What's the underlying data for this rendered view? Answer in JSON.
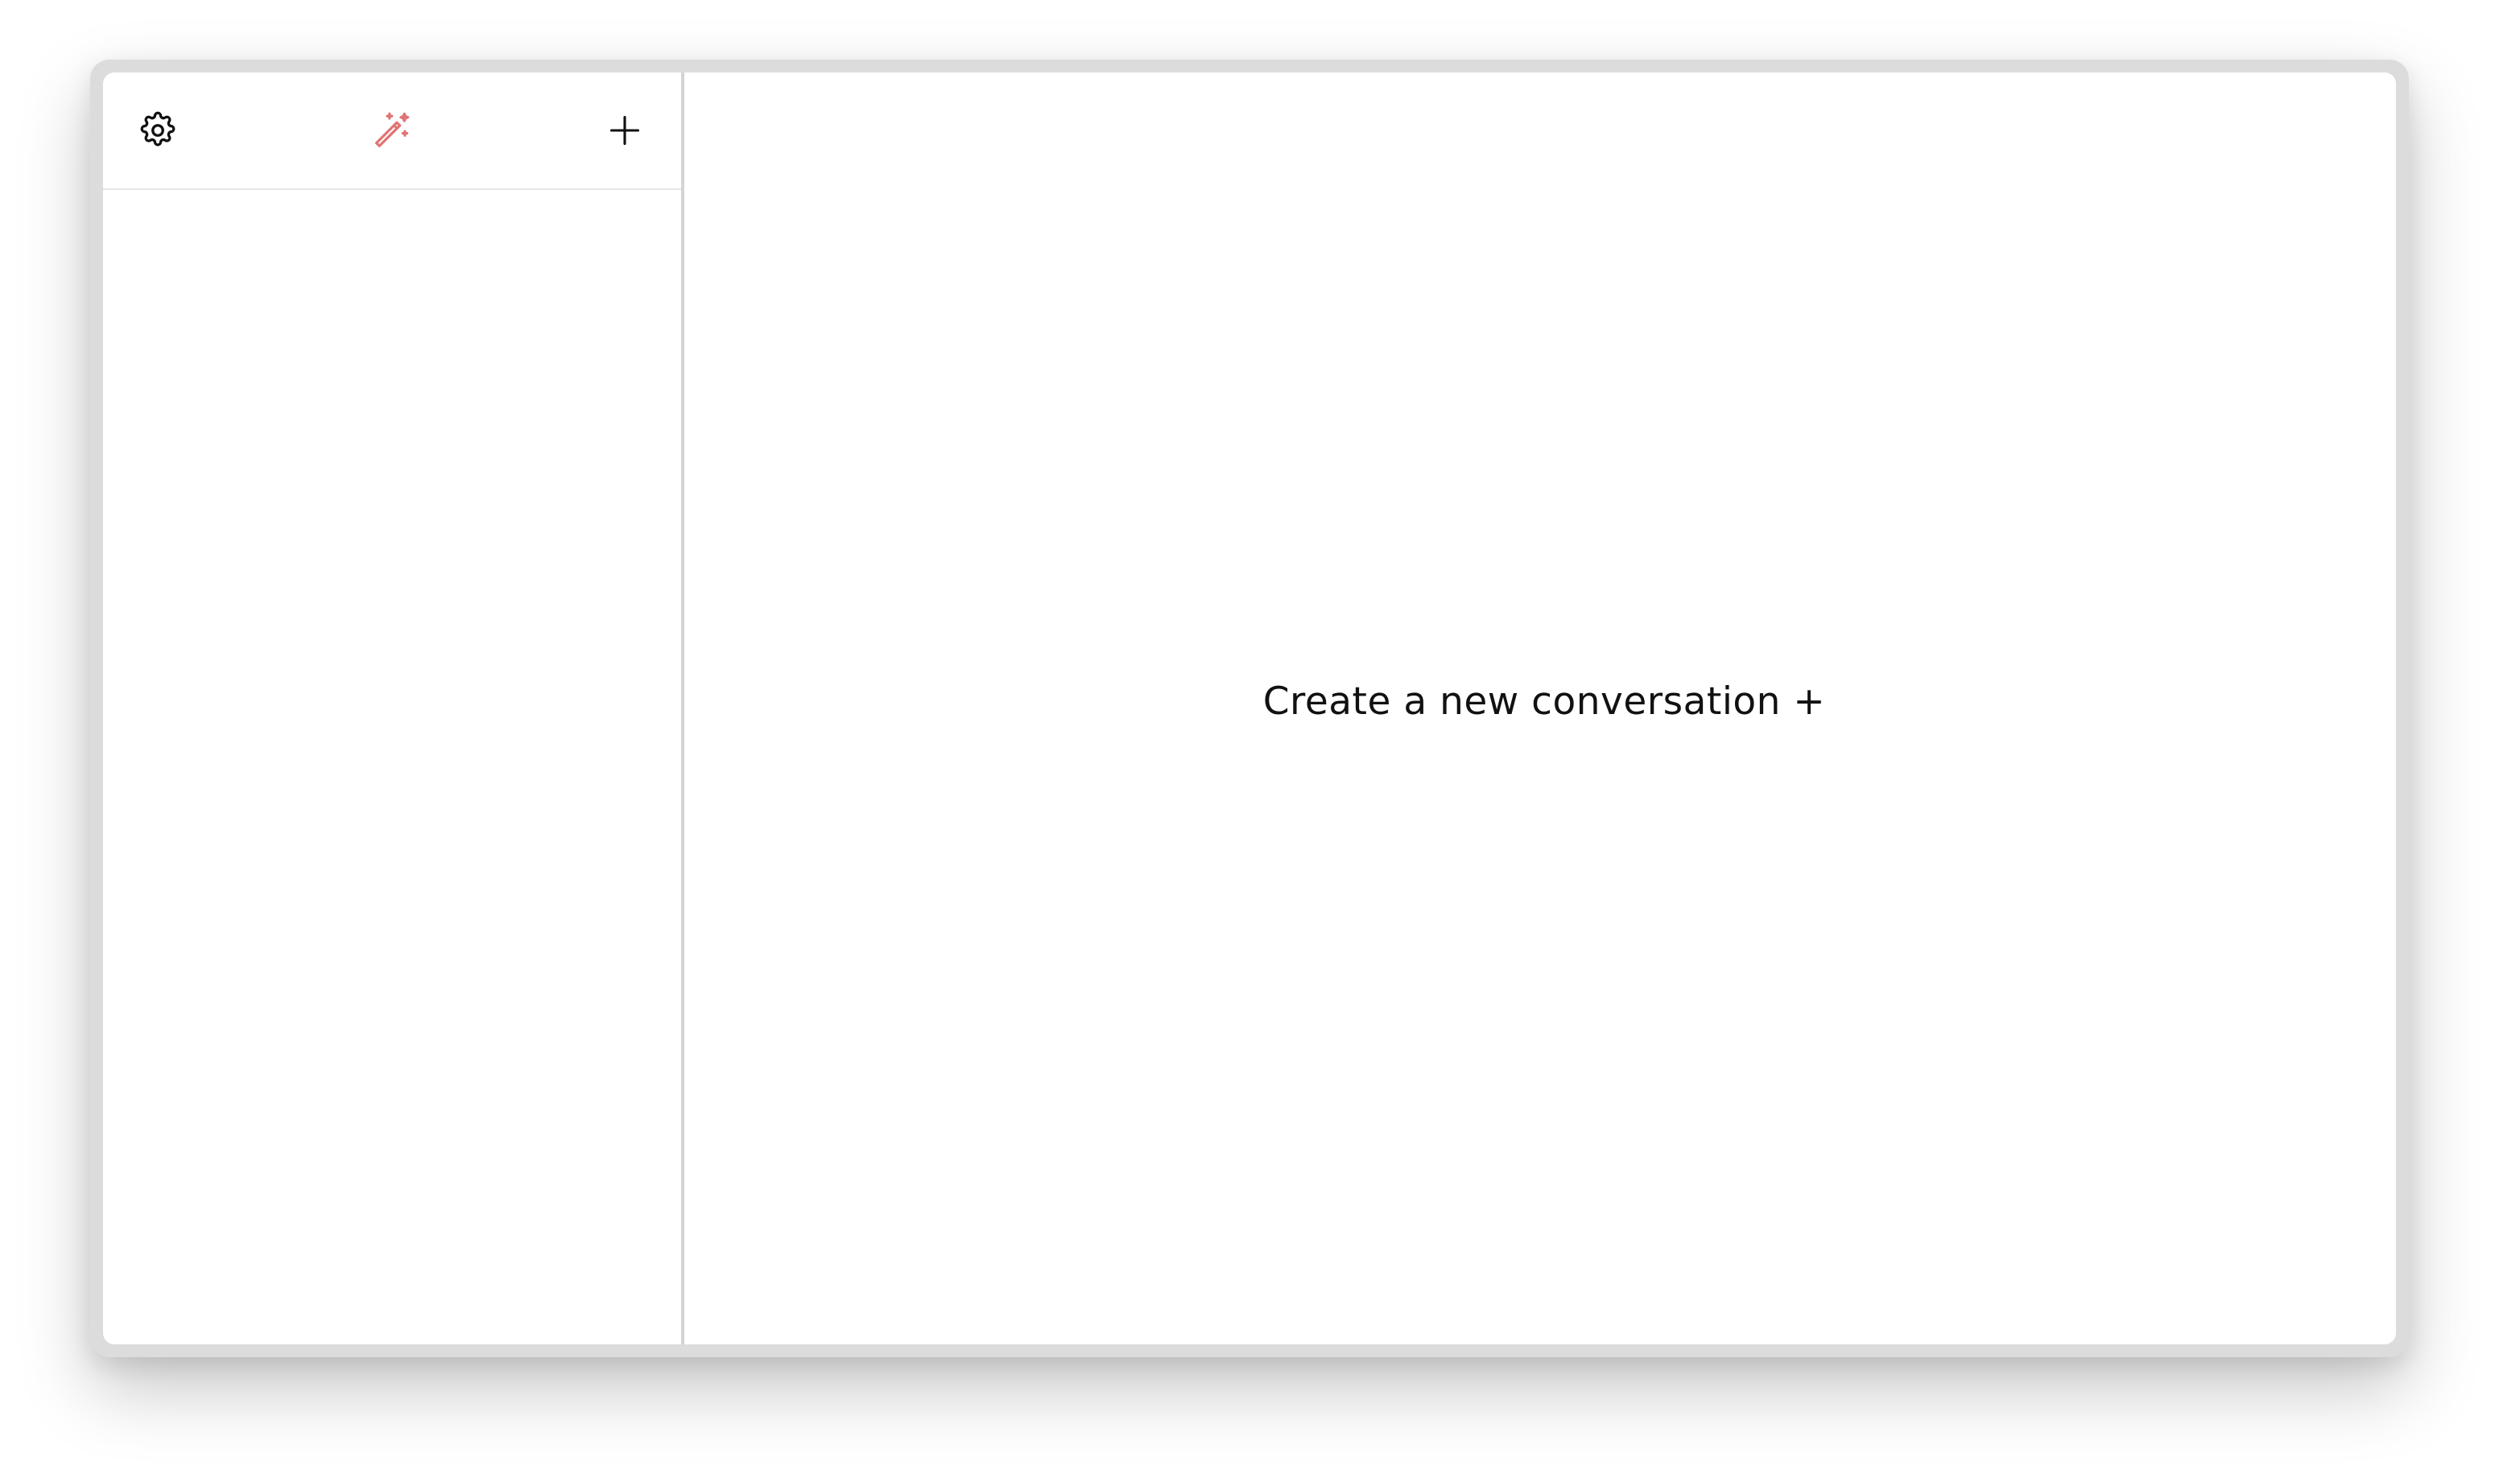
{
  "sidebar": {
    "header": {
      "settings_icon": "gear-icon",
      "magic_icon": "magic-wand-icon",
      "new_icon": "plus-icon"
    },
    "items": []
  },
  "main": {
    "empty_state_label": "Create a new conversation +"
  },
  "colors": {
    "accent": "#e07474",
    "text": "#111111",
    "divider": "#d4d4d4",
    "frame": "#dcdcdc"
  }
}
